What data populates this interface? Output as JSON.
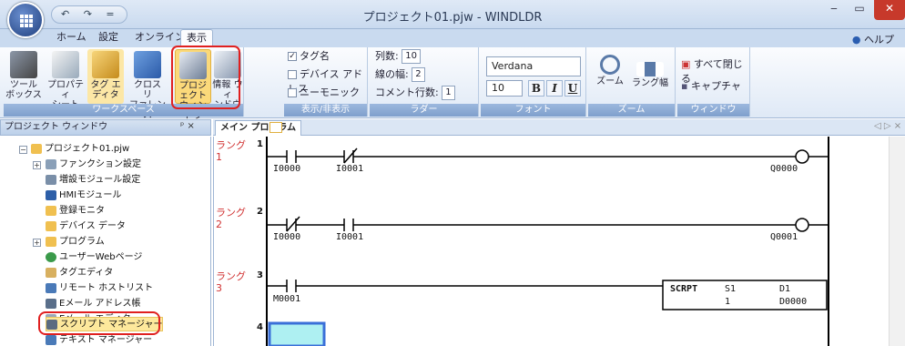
{
  "window": {
    "title": "プロジェクト01.pjw - WINDLDR",
    "qat": "↶ ↷ ="
  },
  "menu_tabs": [
    "ホーム",
    "設定",
    "オンライン",
    "表示"
  ],
  "help_label": "ヘルプ",
  "ribbon": {
    "workspace": {
      "group_label": "ワークスペース",
      "buttons": [
        {
          "line1": "ツール",
          "line2": "ボックス"
        },
        {
          "line1": "プロパティ",
          "line2": "シート"
        },
        {
          "line1": "タグ エ",
          "line2": "ディタ"
        },
        {
          "line1": "クロス リ",
          "line2": "ファレンス"
        },
        {
          "line1": "プロジェクト",
          "line2": "ウィンドウ"
        },
        {
          "line1": "情報 ウィ",
          "line2": "ンドウ"
        }
      ]
    },
    "showhide": {
      "group_label": "表示/非表示",
      "items": [
        {
          "label": "タグ名",
          "checked": true
        },
        {
          "label": "デバイス アドレス",
          "checked": false
        },
        {
          "label": "ニーモニック",
          "checked": false
        }
      ]
    },
    "ladder": {
      "group_label": "ラダー",
      "columns_label": "列数:",
      "columns_value": "10",
      "linewidth_label": "線の幅:",
      "linewidth_value": "2",
      "comment_label": "コメント行数:",
      "comment_value": "1"
    },
    "font": {
      "group_label": "フォント",
      "font_name": "Verdana",
      "font_size": "10",
      "bold": "B",
      "italic": "I",
      "underline": "U"
    },
    "zoom": {
      "group_label": "ズーム",
      "zoom_label": "ズーム",
      "rung_width_label": "ラング幅"
    },
    "window": {
      "group_label": "ウィンドウ",
      "close_all": "すべて閉じる",
      "capture": "キャプチャ"
    }
  },
  "panel": {
    "title": "プロジェクト ウィンドウ",
    "pin": "ᵖ ×",
    "tree": [
      "プロジェクト01.pjw",
      "ファンクション設定",
      "増設モジュール設定",
      "HMIモジュール",
      "登録モニタ",
      "デバイス データ",
      "プログラム",
      "ユーザーWebページ",
      "タグエディタ",
      "リモート ホストリスト",
      "Eメール アドレス帳",
      "Eメール エディタ",
      "スクリプト マネージャー",
      "テキスト マネージャー"
    ]
  },
  "editor": {
    "tab": "メイン プログラム",
    "nav": "◁ ▷ ×",
    "rungs": [
      {
        "label": "ラング",
        "num": "1",
        "idx": "1",
        "contacts": [
          "I0000",
          "I0001"
        ],
        "coil": "Q0000"
      },
      {
        "label": "ラング",
        "num": "2",
        "idx": "2",
        "contacts": [
          "I0000",
          "I0001"
        ],
        "coil": "Q0001"
      },
      {
        "label": "ラング",
        "num": "3",
        "idx": "3",
        "contacts": [
          "M0001"
        ],
        "block": {
          "name": "SCRPT",
          "s1": "S1",
          "s1v": "1",
          "d1": "D1",
          "d1v": "D0000"
        }
      },
      {
        "num": "4"
      }
    ]
  }
}
